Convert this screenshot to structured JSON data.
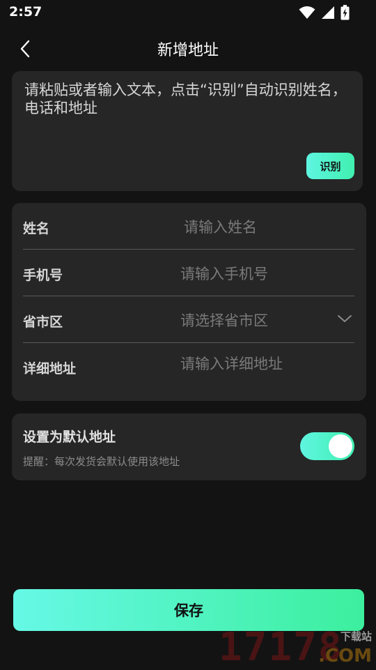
{
  "status_bar": {
    "time": "2:57",
    "icons": [
      "wifi-icon",
      "signal-icon",
      "battery-charging-icon"
    ]
  },
  "header": {
    "back_icon": "chevron-left-icon",
    "title": "新增地址"
  },
  "paste_box": {
    "placeholder": "请粘贴或者输入文本，点击“识别”自动识别姓名，电话和地址",
    "recognize_label": "识别"
  },
  "form": {
    "name": {
      "label": "姓名",
      "placeholder": "请输入姓名"
    },
    "phone": {
      "label": "手机号",
      "placeholder": "请输入手机号"
    },
    "region": {
      "label": "省市区",
      "placeholder": "请选择省市区",
      "icon": "chevron-down-icon"
    },
    "detail": {
      "label": "详细地址",
      "placeholder": "请输入详细地址"
    }
  },
  "default_address": {
    "title": "设置为默认地址",
    "hint": "提醒：每次发货会默认使用该地址",
    "enabled": true
  },
  "save_label": "保存",
  "watermark": {
    "digits": "17178",
    "small": "下载站",
    "domain": ".COM"
  },
  "colors": {
    "background": "#131313",
    "card": "#262626",
    "accent_start": "#5ff5e1",
    "accent_end": "#40f0b0"
  }
}
